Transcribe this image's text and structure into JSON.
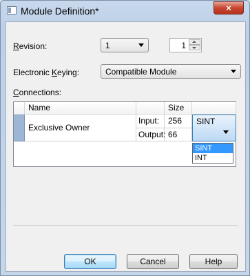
{
  "window": {
    "title": "Module Definition*",
    "close_glyph": "×"
  },
  "revision": {
    "label_u": "R",
    "label_rest": "evision:",
    "major": "1",
    "minor": "1"
  },
  "keying": {
    "label_pre": "Electronic ",
    "label_u": "K",
    "label_rest": "eying:",
    "value": "Compatible Module"
  },
  "connections": {
    "label_u": "C",
    "label_rest": "onnections:",
    "headers": {
      "name": "Name",
      "size": "Size"
    },
    "row": {
      "name": "Exclusive Owner",
      "input_label": "Input:",
      "input_size": "256",
      "output_label": "Output:",
      "output_size": "66",
      "type": "SINT"
    },
    "type_options": [
      "SINT",
      "INT"
    ],
    "selected_option": "SINT"
  },
  "buttons": {
    "ok": "OK",
    "cancel": "Cancel",
    "help": "Help"
  },
  "colors": {
    "title_bar": "#c9d9ec",
    "close": "#c7452e",
    "selection": "#3399ff"
  }
}
